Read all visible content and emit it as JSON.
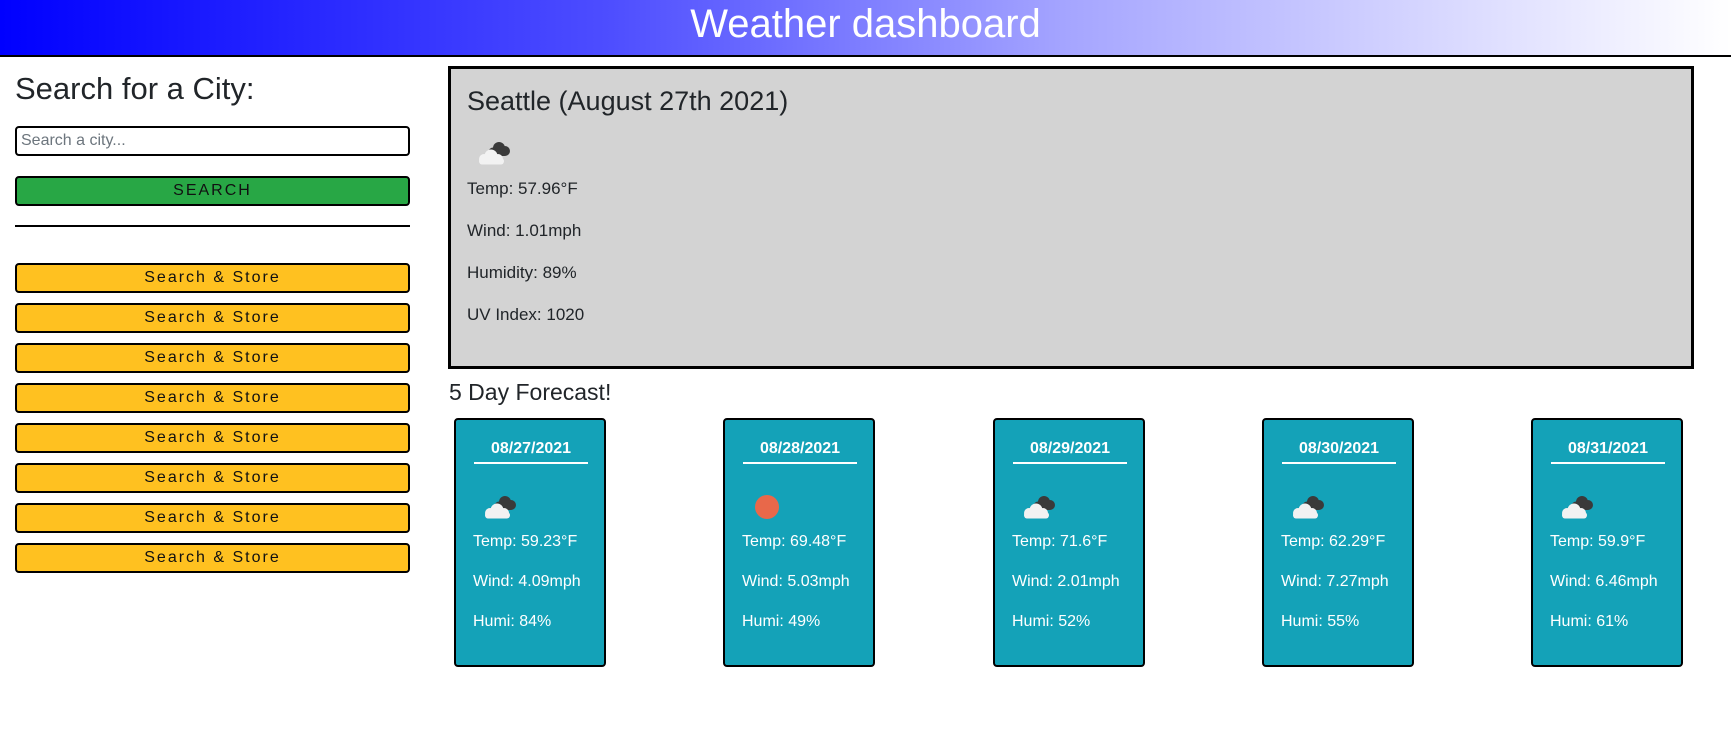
{
  "header": {
    "title": "Weather dashboard"
  },
  "sidebar": {
    "heading": "Search for a City:",
    "search_placeholder": "Search a city...",
    "search_button": "SEARCH",
    "history": [
      "Search & Store",
      "Search & Store",
      "Search & Store",
      "Search & Store",
      "Search & Store",
      "Search & Store",
      "Search & Store",
      "Search & Store"
    ]
  },
  "current": {
    "title": "Seattle (August 27th 2021)",
    "icon": "cloud-icon",
    "temp": "Temp: 57.96°F",
    "wind": "Wind: 1.01mph",
    "humidity": "Humidity: 89%",
    "uv": "UV Index: 1020"
  },
  "forecast": {
    "title": "5 Day Forecast!",
    "days": [
      {
        "date": "08/27/2021",
        "icon": "cloud-icon",
        "temp": "Temp: 59.23°F",
        "wind": "Wind: 4.09mph",
        "humi": "Humi: 84%"
      },
      {
        "date": "08/28/2021",
        "icon": "sun-icon",
        "temp": "Temp: 69.48°F",
        "wind": "Wind: 5.03mph",
        "humi": "Humi: 49%"
      },
      {
        "date": "08/29/2021",
        "icon": "cloud-icon",
        "temp": "Temp: 71.6°F",
        "wind": "Wind: 2.01mph",
        "humi": "Humi: 52%"
      },
      {
        "date": "08/30/2021",
        "icon": "cloud-icon",
        "temp": "Temp: 62.29°F",
        "wind": "Wind: 7.27mph",
        "humi": "Humi: 55%"
      },
      {
        "date": "08/31/2021",
        "icon": "cloud-icon",
        "temp": "Temp: 59.9°F",
        "wind": "Wind: 6.46mph",
        "humi": "Humi: 61%"
      }
    ]
  },
  "colors": {
    "search_button": "#28a745",
    "history_button": "#ffc120",
    "current_panel": "#d3d3d3",
    "forecast_card": "#14a2b8",
    "sun": "#e8684a"
  }
}
